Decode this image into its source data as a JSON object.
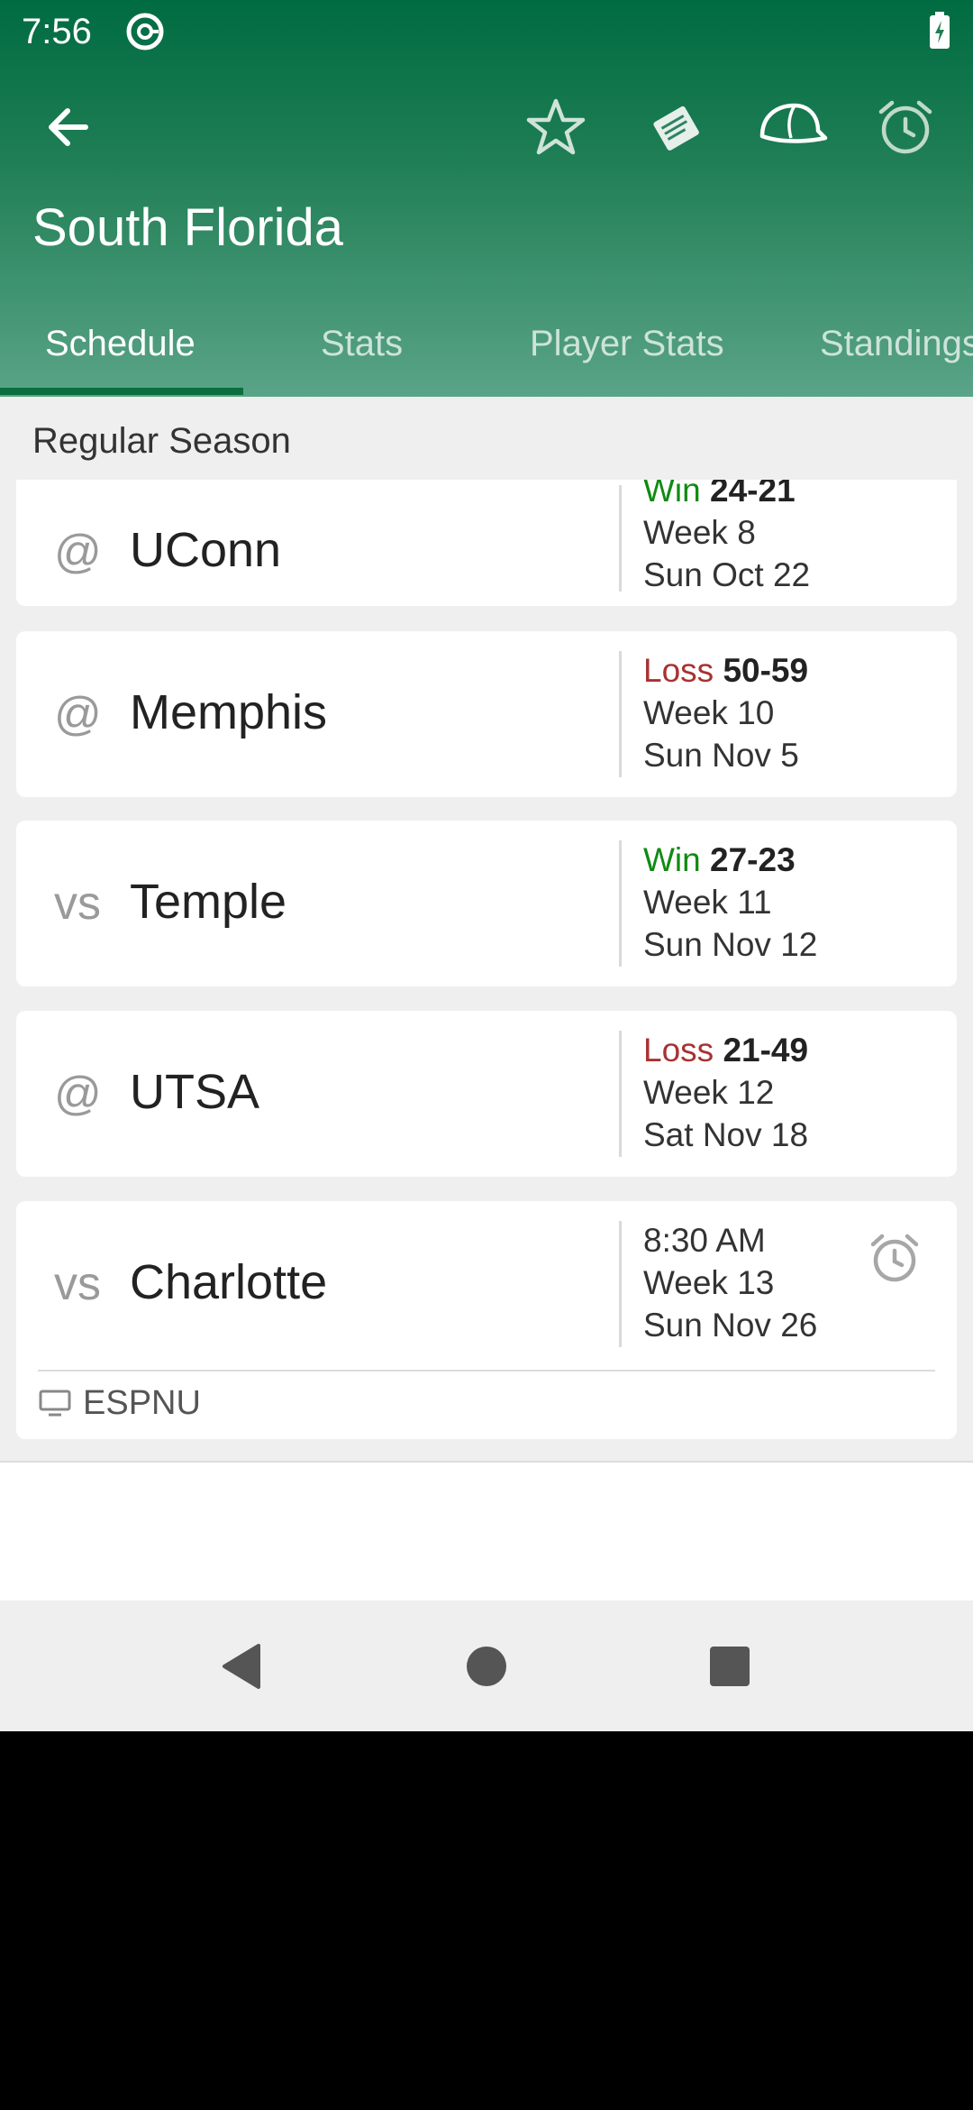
{
  "status_bar": {
    "time": "7:56",
    "icons": [
      "at-sign-icon",
      "battery-charging-icon"
    ]
  },
  "toolbar": {
    "back_icon": "arrow-left-icon",
    "actions": [
      "star-icon",
      "tickets-icon",
      "cap-icon",
      "alarm-clock-icon"
    ]
  },
  "team": {
    "title": "South Florida"
  },
  "tabs": [
    {
      "label": "Schedule",
      "active": true
    },
    {
      "label": "Stats",
      "active": false
    },
    {
      "label": "Player Stats",
      "active": false
    },
    {
      "label": "Standings",
      "active": false
    }
  ],
  "section": {
    "title": "Regular Season"
  },
  "games": [
    {
      "prefix": "@",
      "opponent": "UConn",
      "result": "Win",
      "score": "24-21",
      "week": "Week 8",
      "date": "Sun Oct 22"
    },
    {
      "prefix": "@",
      "opponent": "Memphis",
      "result": "Loss",
      "score": "50-59",
      "week": "Week 10",
      "date": "Sun Nov 5"
    },
    {
      "prefix": "vs",
      "opponent": "Temple",
      "result": "Win",
      "score": "27-23",
      "week": "Week 11",
      "date": "Sun Nov 12"
    },
    {
      "prefix": "@",
      "opponent": "UTSA",
      "result": "Loss",
      "score": "21-49",
      "week": "Week 12",
      "date": "Sat Nov 18"
    },
    {
      "prefix": "vs",
      "opponent": "Charlotte",
      "time": "8:30 AM",
      "week": "Week 13",
      "date": "Sun Nov 26",
      "tv": "ESPNU",
      "alarm_icon": "alarm-clock-icon",
      "tv_icon": "tv-icon"
    }
  ],
  "colors": {
    "header_top": "#006b41",
    "header_bottom": "#5aa487",
    "win": "#118a11",
    "loss": "#a83232"
  },
  "nav": {
    "icons": [
      "back-triangle-icon",
      "home-circle-icon",
      "recents-square-icon"
    ]
  }
}
